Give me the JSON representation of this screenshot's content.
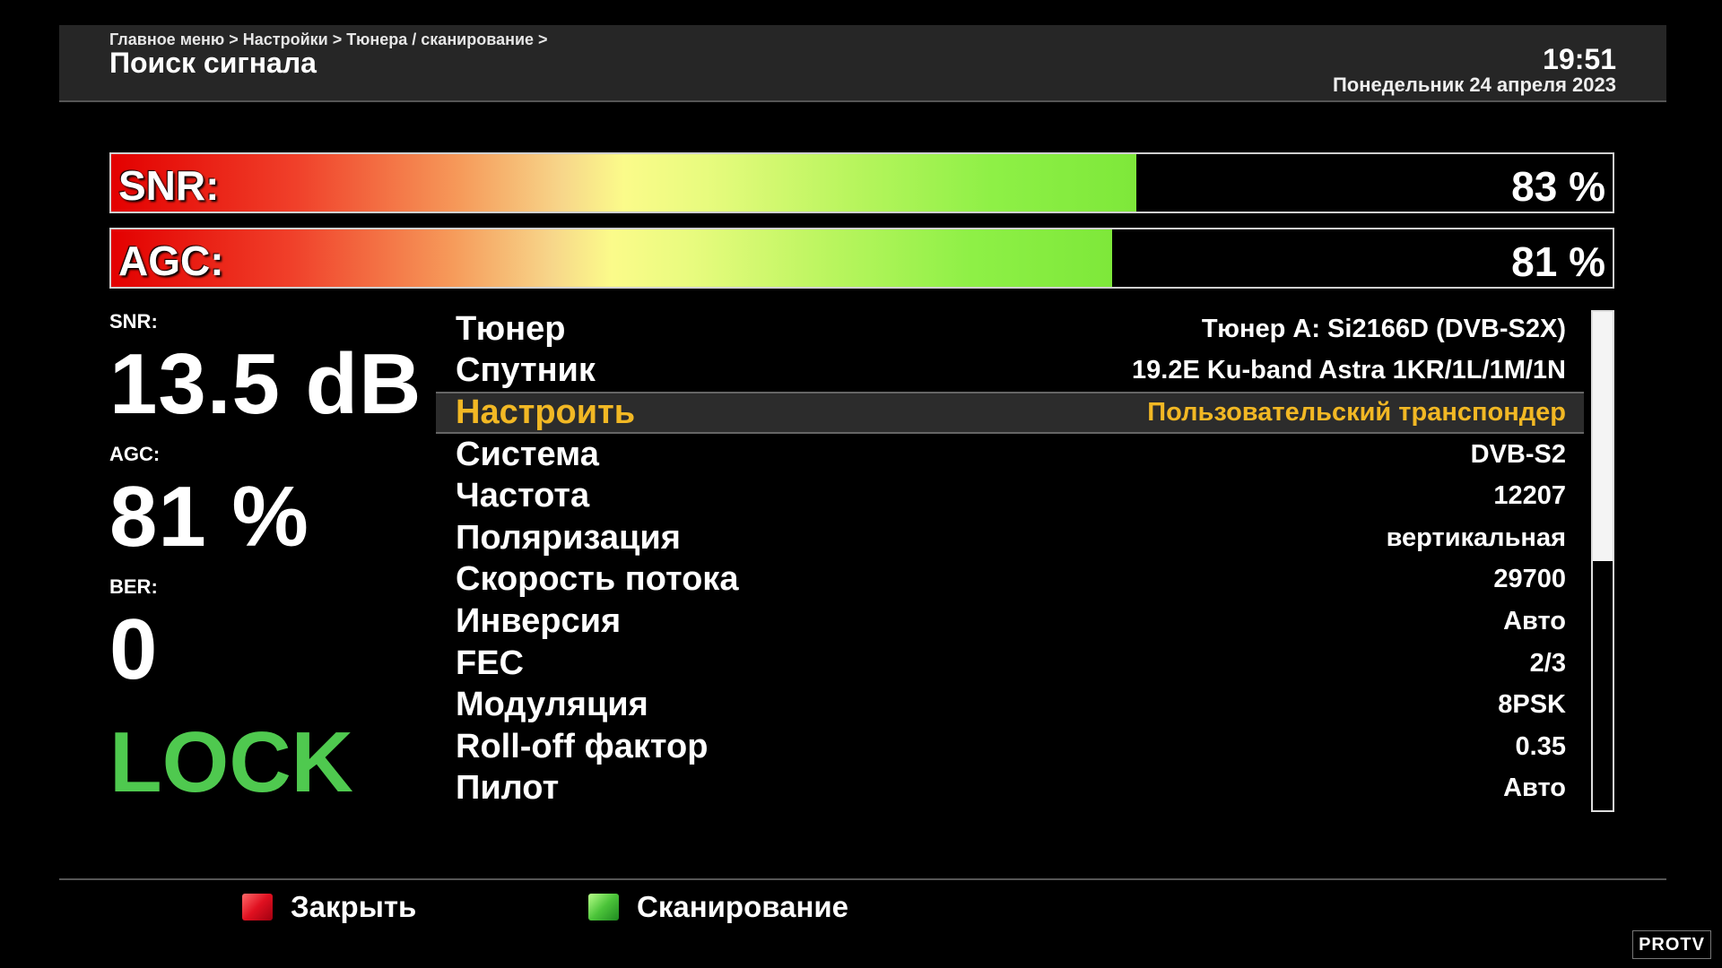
{
  "header": {
    "breadcrumb": "Главное меню > Настройки > Тюнера / сканирование >",
    "title": "Поиск сигнала",
    "time": "19:51",
    "date": "Понедельник 24 апреля 2023"
  },
  "bars": {
    "snr": {
      "label": "SNR:",
      "value_text": "83 %",
      "percent": 83
    },
    "agc": {
      "label": "AGC:",
      "value_text": "81 %",
      "percent": 81
    }
  },
  "stats": {
    "snr_label": "SNR:",
    "snr_value": "13.5 dB",
    "agc_label": "AGC:",
    "agc_value": "81 %",
    "ber_label": "BER:",
    "ber_value": "0",
    "lock": "LOCK"
  },
  "params": [
    {
      "name": "Тюнер",
      "value": "Тюнер A: Si2166D (DVB-S2X)"
    },
    {
      "name": "Спутник",
      "value": "19.2E Ku-band Astra 1KR/1L/1M/1N"
    },
    {
      "name": "Настроить",
      "value": "Пользовательский транспондер",
      "selected": true
    },
    {
      "name": "Система",
      "value": "DVB-S2"
    },
    {
      "name": "Частота",
      "value": "12207"
    },
    {
      "name": "Поляризация",
      "value": "вертикальная"
    },
    {
      "name": "Скорость потока",
      "value": "29700"
    },
    {
      "name": "Инверсия",
      "value": "Авто"
    },
    {
      "name": "FEC",
      "value": "2/3"
    },
    {
      "name": "Модуляция",
      "value": "8PSK"
    },
    {
      "name": "Roll-off фактор",
      "value": "0.35"
    },
    {
      "name": "Пилот",
      "value": "Авто"
    }
  ],
  "scroll": {
    "thumb_fraction": 0.5
  },
  "footer": {
    "red_label": "Закрыть",
    "green_label": "Сканирование",
    "red_color": "#e01020",
    "green_color": "#4cc43a"
  },
  "colors": {
    "selected_text": "#f2b824",
    "lock_text": "#4fc94f"
  },
  "watermark": {
    "text": "PROTV"
  }
}
